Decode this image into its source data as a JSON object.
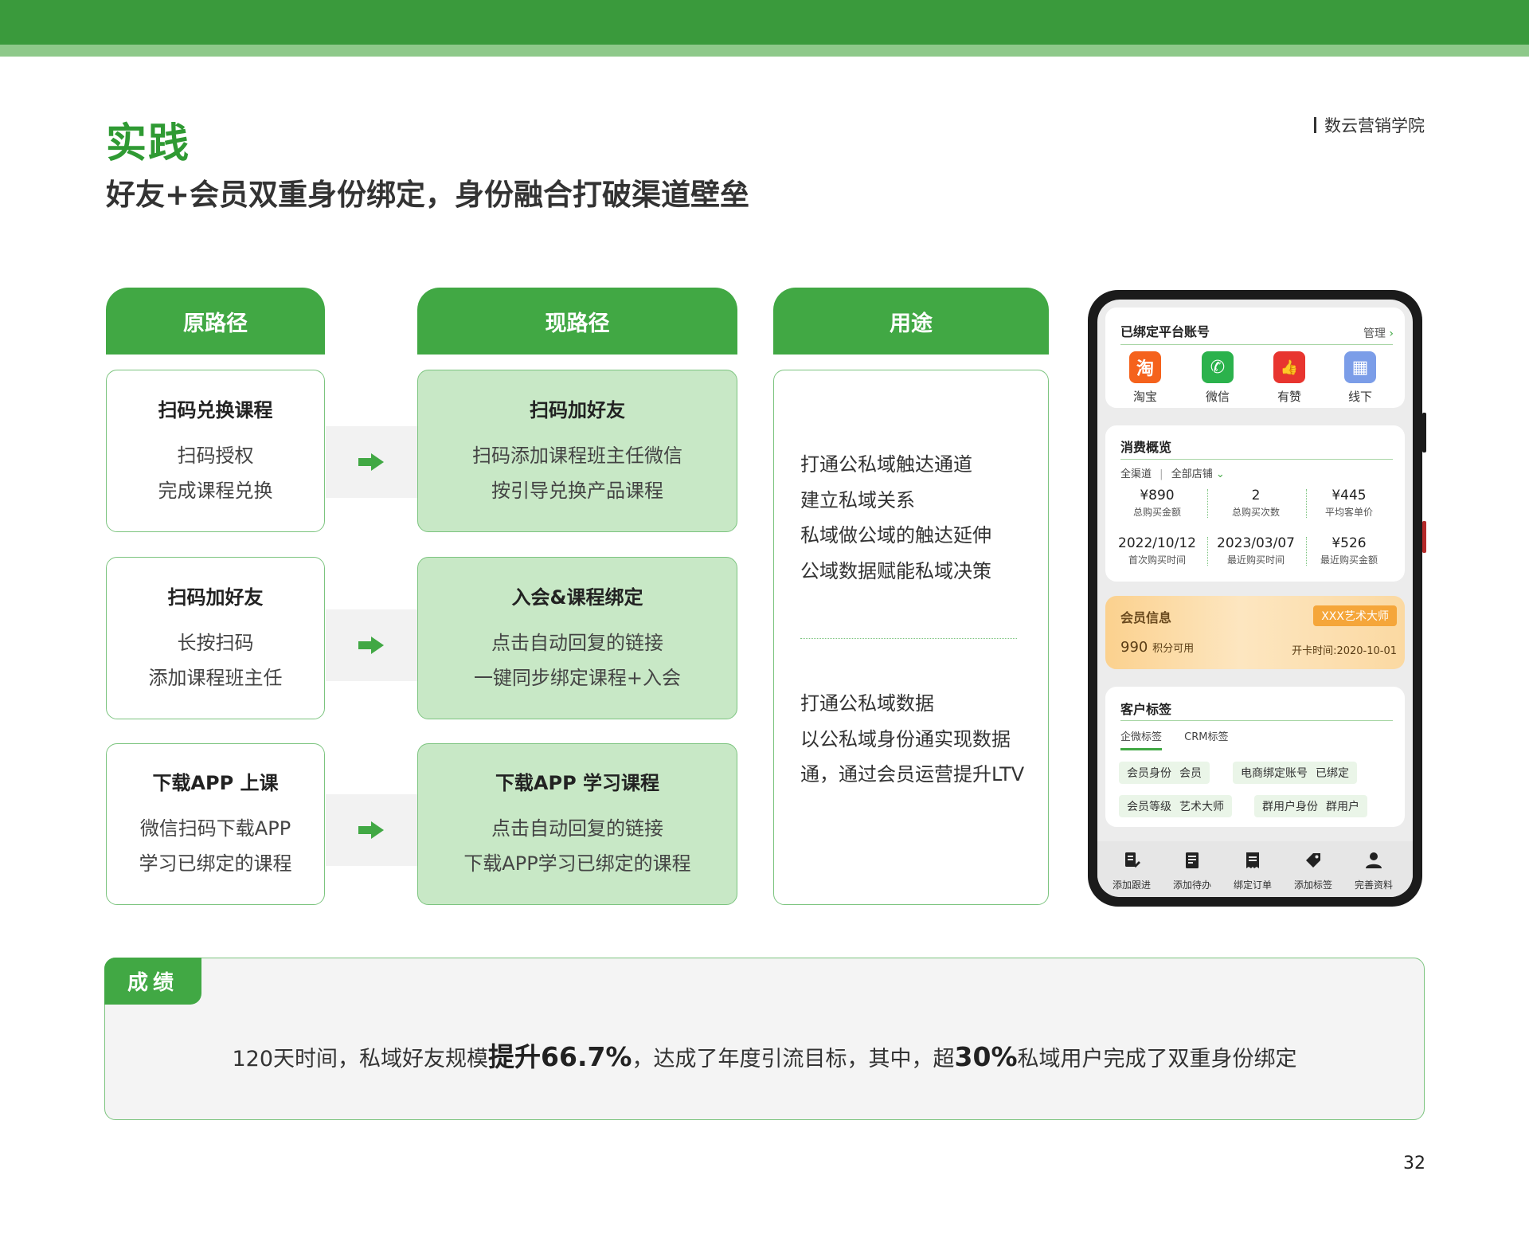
{
  "header": {
    "title": "实践",
    "subtitle": "好友+会员双重身份绑定，身份融合打破渠道壁垒",
    "brand": "数云营销学院"
  },
  "columns": {
    "original": "原路径",
    "current": "现路径",
    "usage": "用途"
  },
  "original_paths": [
    {
      "title": "扫码兑换课程",
      "lines": [
        "扫码授权",
        "完成课程兑换"
      ]
    },
    {
      "title": "扫码加好友",
      "lines": [
        "长按扫码",
        "添加课程班主任"
      ]
    },
    {
      "title": "下载APP 上课",
      "lines": [
        "微信扫码下载APP",
        "学习已绑定的课程"
      ]
    }
  ],
  "current_paths": [
    {
      "title": "扫码加好友",
      "lines": [
        "扫码添加课程班主任微信",
        "按引导兑换产品课程"
      ]
    },
    {
      "title": "入会&课程绑定",
      "lines": [
        "点击自动回复的链接",
        "一键同步绑定课程+入会"
      ]
    },
    {
      "title": "下载APP 学习课程",
      "lines": [
        "点击自动回复的链接",
        "下载APP学习已绑定的课程"
      ]
    }
  ],
  "usage": {
    "group1": [
      "打通公私域触达通道",
      "建立私域关系",
      "私域做公域的触达延伸",
      "公域数据赋能私域决策"
    ],
    "group2": [
      "打通公私域数据",
      "以公私域身份通实现数据",
      "通，通过会员运营提升LTV"
    ]
  },
  "phone": {
    "bound_accounts": {
      "title": "已绑定平台账号",
      "manage": "管理",
      "platforms": [
        {
          "name": "淘宝",
          "glyph": "淘",
          "color": "#f5621c"
        },
        {
          "name": "微信",
          "glyph": "✆",
          "color": "#2bb24c"
        },
        {
          "name": "有赞",
          "glyph": "👍",
          "color": "#e8352f"
        },
        {
          "name": "线下",
          "glyph": "▦",
          "color": "#7b9de8"
        }
      ]
    },
    "consumption": {
      "title": "消费概览",
      "filter_channel": "全渠道",
      "filter_store": "全部店铺",
      "stats_row1": [
        {
          "value": "¥890",
          "label": "总购买金额"
        },
        {
          "value": "2",
          "label": "总购买次数"
        },
        {
          "value": "¥445",
          "label": "平均客单价"
        }
      ],
      "stats_row2": [
        {
          "value": "2022/10/12",
          "label": "首次购买时间"
        },
        {
          "value": "2023/03/07",
          "label": "最近购买时间"
        },
        {
          "value": "¥526",
          "label": "最近购买金额"
        }
      ]
    },
    "member": {
      "title": "会员信息",
      "badge": "XXX艺术大师",
      "points": "990",
      "points_label": "积分可用",
      "since": "开卡时间:2020-10-01"
    },
    "tags": {
      "title": "客户标签",
      "tab_active": "企微标签",
      "tab_other": "CRM标签",
      "items": [
        {
          "key": "会员身份",
          "value": "会员"
        },
        {
          "key": "电商绑定账号",
          "value": "已绑定"
        },
        {
          "key": "会员等级",
          "value": "艺术大师"
        },
        {
          "key": "群用户身份",
          "value": "群用户"
        }
      ]
    },
    "toolbar": [
      "添加跟进",
      "添加待办",
      "绑定订单",
      "添加标签",
      "完善资料"
    ]
  },
  "result": {
    "tag": "成绩",
    "text_1": "120天时间，私域好友规模",
    "highlight_1": "提升66.7%",
    "text_2": "，达成了年度引流目标，其中，超",
    "highlight_2": "30%",
    "text_3": "私域用户完成了双重身份绑定"
  },
  "page_number": "32",
  "colors": {
    "primary_green": "#41a844",
    "light_green": "#c8e8c6",
    "title_green": "#2f9a33"
  }
}
